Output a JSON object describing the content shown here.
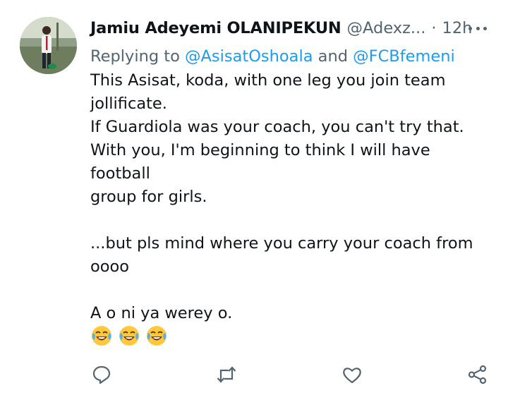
{
  "tweet": {
    "author_name": "Jamiu Adeyemi OLANIPEKUN",
    "author_handle": "@Adexz...",
    "separator": "·",
    "time": "12h",
    "avatar_icon": "profile-photo",
    "more_icon": "more-options-icon",
    "replying": {
      "prefix": "Replying to ",
      "mention_1": "@AsisatOshoala",
      "conjunction": " and ",
      "mention_2": "@FCBfemeni"
    },
    "text_lines": [
      "This Asisat, koda, with one leg you join team",
      "jollificate.",
      "If Guardiola was your coach, you can't try that.",
      "With you, I'm beginning to think I will have football",
      "group for girls.",
      "",
      "...but pls mind where you carry your coach from",
      "oooo",
      "",
      "A o ni ya werey o."
    ],
    "emojis": [
      "😂",
      "😂",
      "😂"
    ]
  },
  "actions": {
    "reply_icon": "reply-icon",
    "retweet_icon": "retweet-icon",
    "like_icon": "heart-icon",
    "share_icon": "share-icon"
  },
  "colors": {
    "text_primary": "#0f1419",
    "text_secondary": "#536471",
    "link": "#1d9bf0",
    "background": "#ffffff"
  }
}
